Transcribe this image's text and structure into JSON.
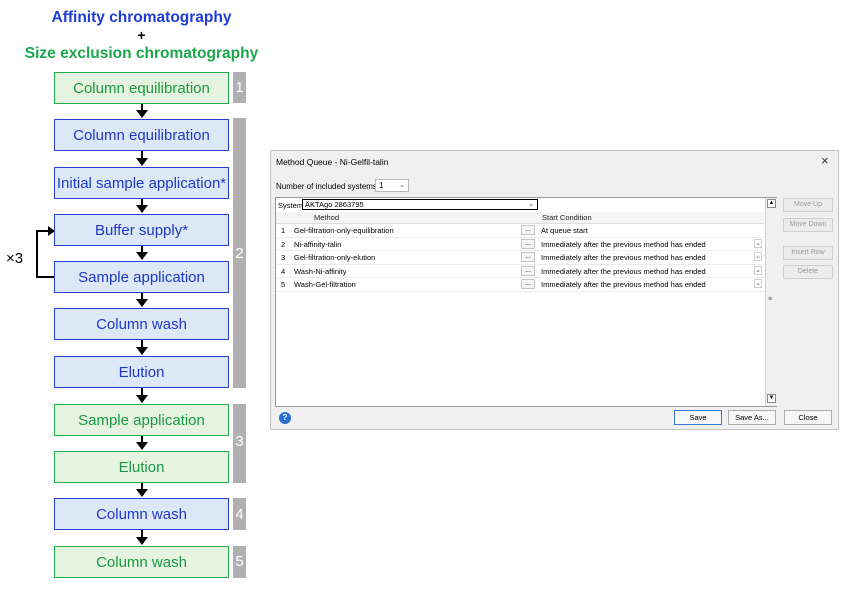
{
  "diagram": {
    "title_affinity": "Affinity chromatography",
    "plus": "+",
    "title_sec": "Size exclusion chromatography",
    "steps": [
      {
        "label": "Column equilibration",
        "color": "green"
      },
      {
        "label": "Column equilibration",
        "color": "blue"
      },
      {
        "label": "Initial sample application*",
        "color": "blue"
      },
      {
        "label": "Buffer supply*",
        "color": "blue"
      },
      {
        "label": "Sample application",
        "color": "blue"
      },
      {
        "label": "Column wash",
        "color": "blue"
      },
      {
        "label": "Elution",
        "color": "blue"
      },
      {
        "label": "Sample application",
        "color": "green"
      },
      {
        "label": "Elution",
        "color": "green"
      },
      {
        "label": "Column wash",
        "color": "blue"
      },
      {
        "label": "Column wash",
        "color": "green"
      }
    ],
    "loop_label": "×3",
    "stage_numbers": [
      "1",
      "2",
      "3",
      "4",
      "5"
    ],
    "colors": {
      "green_border": "#22b04b",
      "green_fill": "#e6f3e0",
      "blue_border": "#2440d8",
      "blue_fill": "#dde8f7",
      "stage_bar": "#b0b0b0"
    }
  },
  "dialog": {
    "title": "Method Queue - Ni-Gelfil-talin",
    "close_glyph": "×",
    "systems_label": "Number of included systems:",
    "systems_value": "1",
    "system_label": "System",
    "system_value": "ÄKTAgo 2863795",
    "col_method": "Method",
    "col_condition": "Start Condition",
    "rows": [
      {
        "num": "1",
        "method": "Gel-filtration-only-equilibration",
        "condition": "At queue start",
        "has_dropdown": false
      },
      {
        "num": "2",
        "method": "Ni-affinity-talin",
        "condition": "Immediately after the previous method has ended",
        "has_dropdown": true
      },
      {
        "num": "3",
        "method": "Gel-filtration-only-elution",
        "condition": "Immediately after the previous method has ended",
        "has_dropdown": true
      },
      {
        "num": "4",
        "method": "Wash-Ni-affinity",
        "condition": "Immediately after the previous method has ended",
        "has_dropdown": true
      },
      {
        "num": "5",
        "method": "Wash-Gel-filtration",
        "condition": "Immediately after the previous method has ended",
        "has_dropdown": true
      }
    ],
    "browse_label": "...",
    "side_buttons": {
      "move_up": "Move Up",
      "move_down": "Move Down",
      "insert_row": "Insert Row",
      "delete": "Delete"
    },
    "buttons": {
      "save": "Save",
      "save_as": "Save As...",
      "close": "Close"
    },
    "help_glyph": "?"
  }
}
